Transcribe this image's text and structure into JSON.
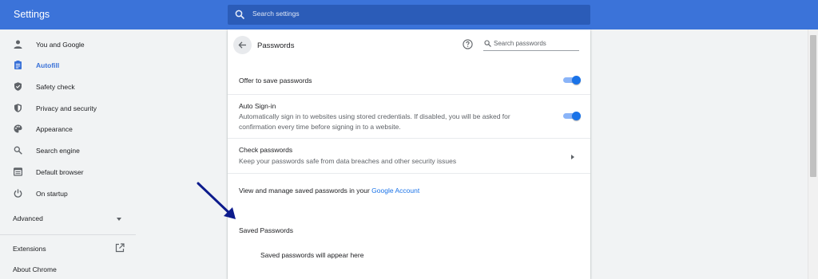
{
  "header": {
    "title": "Settings",
    "search_placeholder": "Search settings",
    "bg_color": "#3b73d9"
  },
  "sidebar": {
    "items": [
      {
        "label": "You and Google",
        "icon": "person-icon"
      },
      {
        "label": "Autofill",
        "icon": "clipboard-icon",
        "active": true
      },
      {
        "label": "Safety check",
        "icon": "shield-check-icon"
      },
      {
        "label": "Privacy and security",
        "icon": "shield-icon"
      },
      {
        "label": "Appearance",
        "icon": "palette-icon"
      },
      {
        "label": "Search engine",
        "icon": "search-icon"
      },
      {
        "label": "Default browser",
        "icon": "browser-icon"
      },
      {
        "label": "On startup",
        "icon": "power-icon"
      }
    ],
    "advanced_label": "Advanced",
    "extensions_label": "Extensions",
    "about_label": "About Chrome",
    "accent_color": "#3a72d8"
  },
  "passwords_page": {
    "title": "Passwords",
    "search_placeholder": "Search passwords",
    "offer_to_save": {
      "label": "Offer to save passwords",
      "enabled": true
    },
    "auto_signin": {
      "label": "Auto Sign-in",
      "description": "Automatically sign in to websites using stored credentials. If disabled, you will be asked for confirmation every time before signing in to a website.",
      "enabled": true
    },
    "check_passwords": {
      "label": "Check passwords",
      "description": "Keep your passwords safe from data breaches and other security issues"
    },
    "manage_text": "View and manage saved passwords in your ",
    "manage_link": "Google Account",
    "saved_title": "Saved Passwords",
    "empty_text": "Saved passwords will appear here",
    "link_color": "#1a73e8",
    "toggle_color": "#1a73e8"
  },
  "annotation": {
    "arrow_color": "#0d1b8c"
  }
}
